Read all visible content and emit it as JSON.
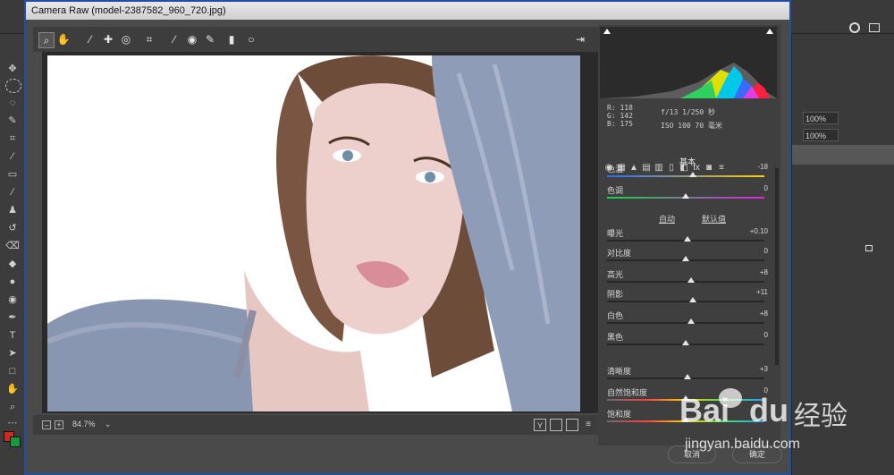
{
  "window": {
    "title": "Camera Raw (model-2387582_960_720.jpg)"
  },
  "ps_top": {
    "percent_1": "100%",
    "percent_2": "100%"
  },
  "toolbar": {
    "icons": [
      "zoom-icon",
      "hand-icon",
      "white-balance-icon",
      "color-sampler-icon",
      "targeted-adjustment-icon",
      "crop-icon",
      "straighten-icon",
      "red-eye-icon",
      "spot-removal-icon",
      "brush-icon",
      "graduated-filter-icon",
      "radial-filter-icon",
      "open-prefs-icon"
    ]
  },
  "histogram": {
    "rgb": [
      "R:  118",
      "G:  142",
      "B:  175"
    ],
    "camera": [
      "f/13   1/250 秒",
      "ISO 100   70 毫米"
    ]
  },
  "panel": {
    "section_title": "基本",
    "sliders": [
      {
        "label": "色温",
        "value": "-18"
      },
      {
        "label": "色调",
        "value": "0"
      },
      {
        "label": "曝光",
        "value": "+0.10"
      },
      {
        "label": "对比度",
        "value": "0"
      },
      {
        "label": "高光",
        "value": "+8"
      },
      {
        "label": "阴影",
        "value": "+11"
      },
      {
        "label": "白色",
        "value": "+8"
      },
      {
        "label": "黑色",
        "value": "0"
      },
      {
        "label": "清晰度",
        "value": "+3"
      },
      {
        "label": "自然饱和度",
        "value": "0"
      },
      {
        "label": "饱和度",
        "value": ""
      }
    ],
    "auto_label": "自动",
    "default_label": "默认值"
  },
  "bottom": {
    "zoom": "84.7%",
    "cancel": "取消",
    "ok": "确定"
  },
  "watermark": {
    "brand": "Bai",
    "brand2": "du",
    "cn": "经验",
    "url": "jingyan.baidu.com"
  }
}
